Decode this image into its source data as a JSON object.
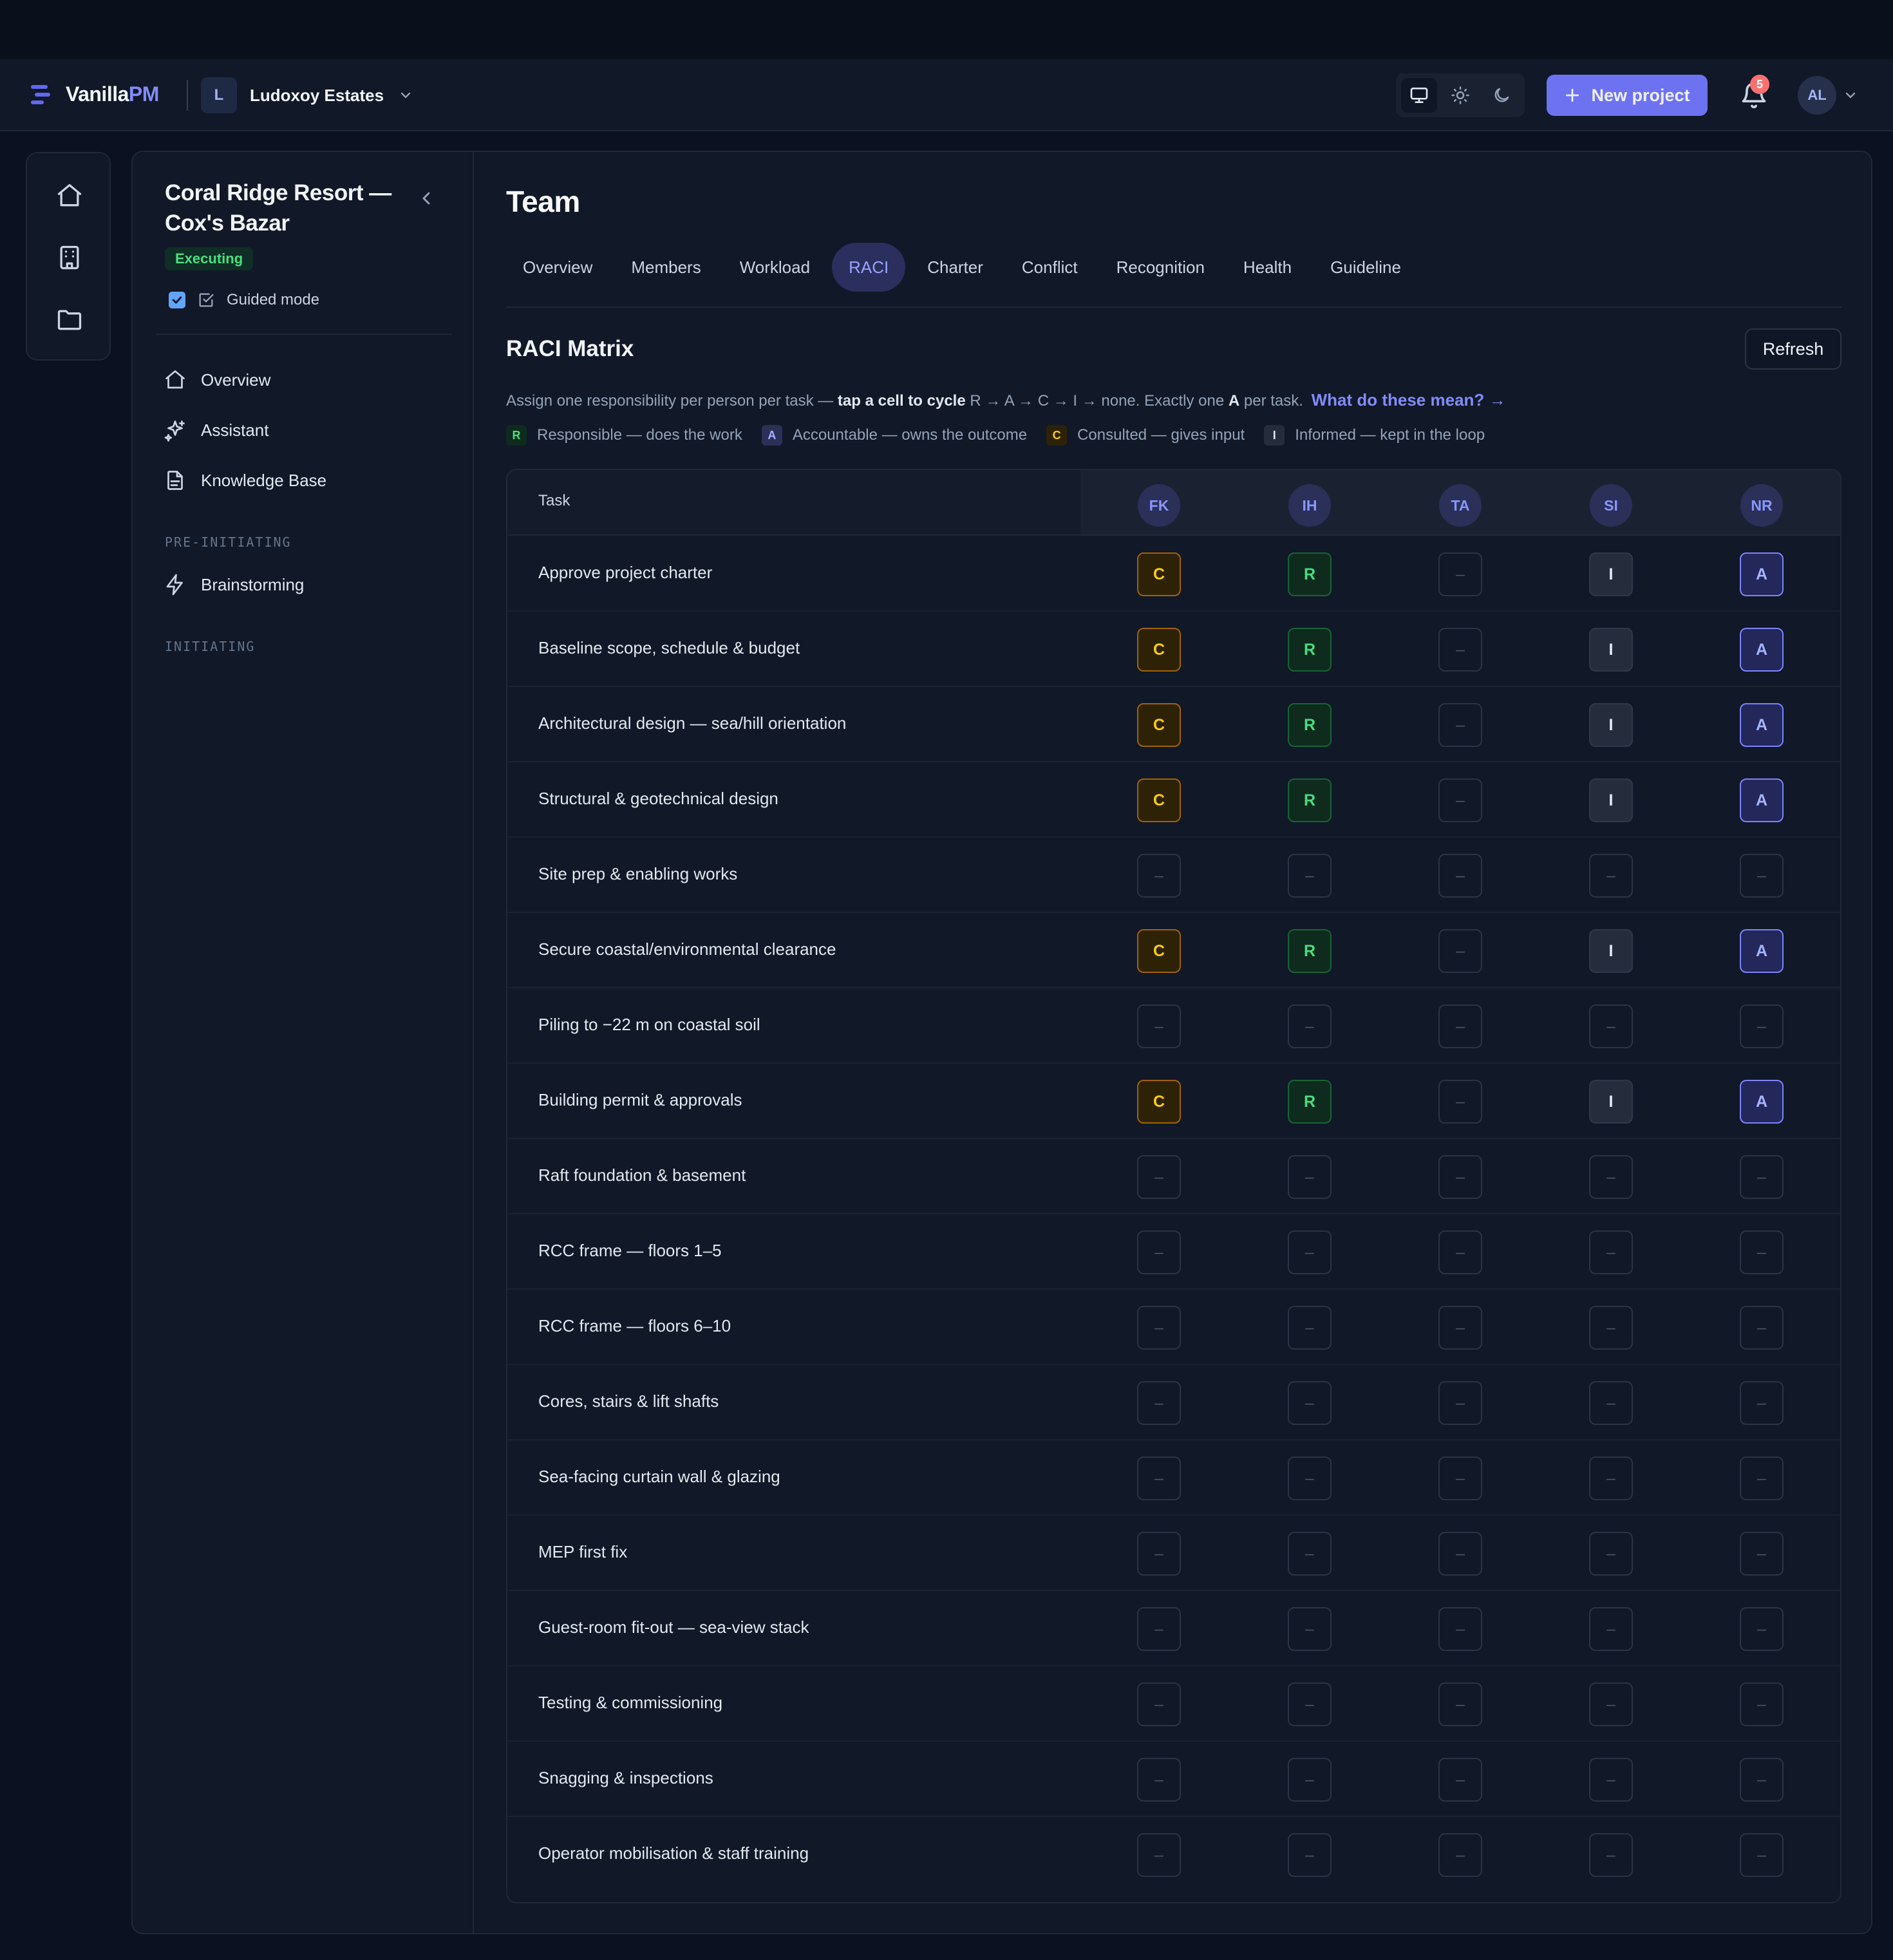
{
  "app": {
    "logo_main": "Vanilla",
    "logo_accent": "PM"
  },
  "org": {
    "initial": "L",
    "name": "Ludoxoy Estates"
  },
  "header": {
    "new_project_label": "New project",
    "notifications_count": "5",
    "user_initials": "AL"
  },
  "project": {
    "title": "Coral Ridge Resort — Cox's Bazar",
    "status": "Executing",
    "guided_mode_label": "Guided mode",
    "guided_mode_checked": true
  },
  "sidebar": {
    "items": [
      {
        "label": "Overview",
        "icon": "home-icon"
      },
      {
        "label": "Assistant",
        "icon": "sparkles-icon"
      },
      {
        "label": "Knowledge Base",
        "icon": "document-icon"
      }
    ],
    "sections": [
      {
        "title": "PRE-INITIATING",
        "items": [
          {
            "label": "Brainstorming",
            "icon": "lightning-icon"
          }
        ]
      },
      {
        "title": "INITIATING",
        "items": []
      }
    ]
  },
  "page": {
    "title": "Team",
    "tabs": [
      "Overview",
      "Members",
      "Workload",
      "RACI",
      "Charter",
      "Conflict",
      "Recognition",
      "Health",
      "Guideline"
    ],
    "active_tab": "RACI"
  },
  "raci": {
    "title": "RACI Matrix",
    "refresh_label": "Refresh",
    "desc_prefix": "Assign one responsibility per person per task — ",
    "desc_bold": "tap a cell to cycle",
    "desc_mid": " R → A → C → I → none. Exactly one ",
    "desc_bold2": "A",
    "desc_suffix": " per task.",
    "help_link": "What do these mean? →",
    "legend": [
      {
        "code": "R",
        "text": "Responsible — does the work"
      },
      {
        "code": "A",
        "text": "Accountable — owns the outcome"
      },
      {
        "code": "C",
        "text": "Consulted — gives input"
      },
      {
        "code": "I",
        "text": "Informed — kept in the loop"
      }
    ],
    "task_header": "Task",
    "people": [
      "FK",
      "IH",
      "TA",
      "SI",
      "NR"
    ],
    "rows": [
      {
        "task": "Approve project charter",
        "cells": [
          "C",
          "R",
          "–",
          "I",
          "A"
        ]
      },
      {
        "task": "Baseline scope, schedule & budget",
        "cells": [
          "C",
          "R",
          "–",
          "I",
          "A"
        ]
      },
      {
        "task": "Architectural design — sea/hill orientation",
        "cells": [
          "C",
          "R",
          "–",
          "I",
          "A"
        ]
      },
      {
        "task": "Structural & geotechnical design",
        "cells": [
          "C",
          "R",
          "–",
          "I",
          "A"
        ]
      },
      {
        "task": "Site prep & enabling works",
        "cells": [
          "–",
          "–",
          "–",
          "–",
          "–"
        ]
      },
      {
        "task": "Secure coastal/environmental clearance",
        "cells": [
          "C",
          "R",
          "–",
          "I",
          "A"
        ]
      },
      {
        "task": "Piling to −22 m on coastal soil",
        "cells": [
          "–",
          "–",
          "–",
          "–",
          "–"
        ]
      },
      {
        "task": "Building permit & approvals",
        "cells": [
          "C",
          "R",
          "–",
          "I",
          "A"
        ]
      },
      {
        "task": "Raft foundation & basement",
        "cells": [
          "–",
          "–",
          "–",
          "–",
          "–"
        ]
      },
      {
        "task": "RCC frame — floors 1–5",
        "cells": [
          "–",
          "–",
          "–",
          "–",
          "–"
        ]
      },
      {
        "task": "RCC frame — floors 6–10",
        "cells": [
          "–",
          "–",
          "–",
          "–",
          "–"
        ]
      },
      {
        "task": "Cores, stairs & lift shafts",
        "cells": [
          "–",
          "–",
          "–",
          "–",
          "–"
        ]
      },
      {
        "task": "Sea-facing curtain wall & glazing",
        "cells": [
          "–",
          "–",
          "–",
          "–",
          "–"
        ]
      },
      {
        "task": "MEP first fix",
        "cells": [
          "–",
          "–",
          "–",
          "–",
          "–"
        ]
      },
      {
        "task": "Guest-room fit-out — sea-view stack",
        "cells": [
          "–",
          "–",
          "–",
          "–",
          "–"
        ]
      },
      {
        "task": "Testing & commissioning",
        "cells": [
          "–",
          "–",
          "–",
          "–",
          "–"
        ]
      },
      {
        "task": "Snagging & inspections",
        "cells": [
          "–",
          "–",
          "–",
          "–",
          "–"
        ]
      },
      {
        "task": "Operator mobilisation & staff training",
        "cells": [
          "–",
          "–",
          "–",
          "–",
          "–"
        ]
      }
    ]
  },
  "colors": {
    "accent": "#6d72f0",
    "responsible": "#4ade80",
    "accountable": "#a5b4fc",
    "consulted": "#facc15",
    "informed": "#e2e8f0"
  }
}
